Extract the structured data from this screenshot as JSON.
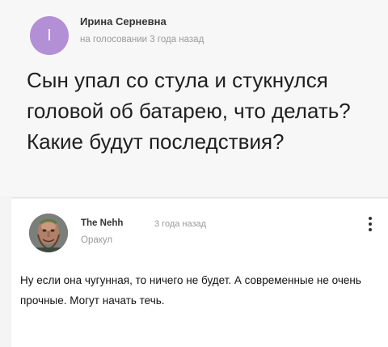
{
  "question": {
    "avatar_letter": "I",
    "author": "Ирина Серневна",
    "meta": "на голосовании 3 года назад",
    "text": "Сын упал со стула и стукнулся головой об батарею, что делать? Какие будут последствия?"
  },
  "answer": {
    "author": "The Nehh",
    "time": "3 года назад",
    "role": "Оракул",
    "text": "Ну если она чугунная, то ничего не будет. А современные не очень прочные. Могут начать течь."
  },
  "icons": {
    "menu": "more-vertical-icon"
  },
  "colors": {
    "question_avatar": "#b38fd6",
    "meta_text": "#9a9a9a"
  }
}
